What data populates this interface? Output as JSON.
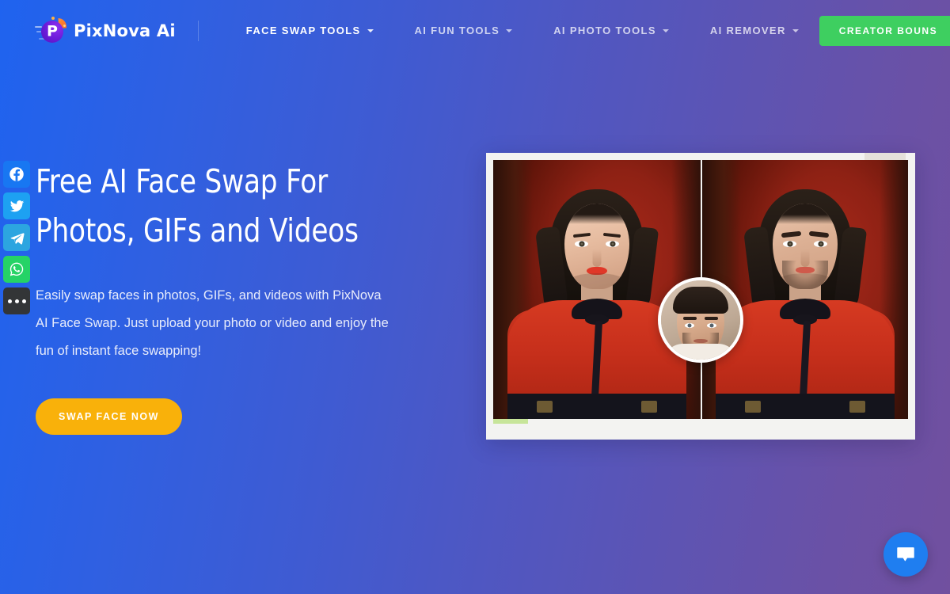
{
  "brand": {
    "name": "PixNova Ai",
    "logo_icon": "pixnova-p-logo-icon"
  },
  "header": {
    "nav": [
      {
        "label": "FACE SWAP TOOLS",
        "active": true,
        "caret": "chevron-down-icon"
      },
      {
        "label": "AI FUN TOOLS",
        "active": false,
        "caret": "chevron-down-icon"
      },
      {
        "label": "AI PHOTO TOOLS",
        "active": false,
        "caret": "chevron-down-icon"
      },
      {
        "label": "AI REMOVER",
        "active": false,
        "caret": "chevron-down-icon"
      }
    ],
    "cta_label": "CREATOR BOUNS",
    "cta_color": "#3ecf60"
  },
  "social_rail": [
    {
      "name": "facebook",
      "icon": "facebook-icon",
      "color": "#1877f2"
    },
    {
      "name": "twitter",
      "icon": "twitter-icon",
      "color": "#1da1f2"
    },
    {
      "name": "telegram",
      "icon": "telegram-icon",
      "color": "#2ca5e0"
    },
    {
      "name": "whatsapp",
      "icon": "whatsapp-icon",
      "color": "#25d366"
    },
    {
      "name": "more",
      "icon": "more-dots-icon",
      "color": "#333537"
    }
  ],
  "hero": {
    "headline": "Free AI Face Swap For\nPhotos, GIFs and Videos",
    "subcopy": "Easily swap faces in photos, GIFs, and videos with PixNova AI Face Swap. Just upload your photo or video and enjoy the fun of instant face swapping!",
    "cta_label": "SWAP FACE NOW",
    "cta_color": "#f9b10a"
  },
  "hero_image": {
    "alt": "Before and after AI face swap comparison: woman in red blouse on the left, same photo with a man's face swapped in on the right",
    "source_face_alt": "Source face thumbnail of a man used for the swap"
  },
  "chat": {
    "icon": "chat-bubble-icon",
    "color": "#1f7ef0"
  },
  "theme": {
    "background_from": "#1f63ef",
    "background_to": "#71509f"
  }
}
